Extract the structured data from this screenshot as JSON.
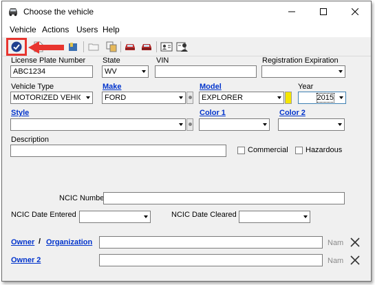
{
  "window": {
    "title": "Choose the vehicle",
    "controls": {
      "minimize": "—",
      "maximize": "☐",
      "close": "✕"
    }
  },
  "menu": [
    "Vehicle",
    "Actions",
    "Users",
    "Help"
  ],
  "toolbar": {
    "highlight_color": "#e8352f",
    "icons": [
      "confirm-check-icon",
      "blank-doc-icon",
      "book-icon",
      "folder-icon",
      "copy-icon",
      "car-red-icon",
      "car-red-2-icon",
      "id-card-icon",
      "id-card-person-icon"
    ]
  },
  "form": {
    "license_plate": {
      "label": "License Plate Number",
      "value": "ABC1234"
    },
    "state": {
      "label": "State",
      "value": "WV"
    },
    "vin": {
      "label": "VIN",
      "value": ""
    },
    "registration_expiration": {
      "label": "Registration Expiration",
      "value": ""
    },
    "vehicle_type": {
      "label": "Vehicle Type",
      "value": "MOTORIZED VEHICLE"
    },
    "make": {
      "label": "Make",
      "value": "FORD"
    },
    "model": {
      "label": "Model",
      "value": "EXPLORER"
    },
    "year": {
      "label": "Year",
      "value": "2015"
    },
    "style": {
      "label": "Style",
      "value": ""
    },
    "color1": {
      "label": "Color 1",
      "value": ""
    },
    "color2": {
      "label": "Color 2",
      "value": ""
    },
    "description": {
      "label": "Description",
      "value": ""
    },
    "commercial": {
      "label": "Commercial",
      "checked": false
    },
    "hazardous": {
      "label": "Hazardous",
      "checked": false
    },
    "ncic_number": {
      "label": "NCIC Number",
      "value": ""
    },
    "ncic_date_entered": {
      "label": "NCIC Date Entered",
      "value": ""
    },
    "ncic_date_cleared": {
      "label": "NCIC Date Cleared",
      "value": ""
    },
    "owner": {
      "label": "Owner",
      "separator": "/",
      "label2": "Organization",
      "value": "",
      "hint": "Nam"
    },
    "owner2": {
      "label": "Owner 2",
      "value": "",
      "hint": "Nam"
    }
  }
}
